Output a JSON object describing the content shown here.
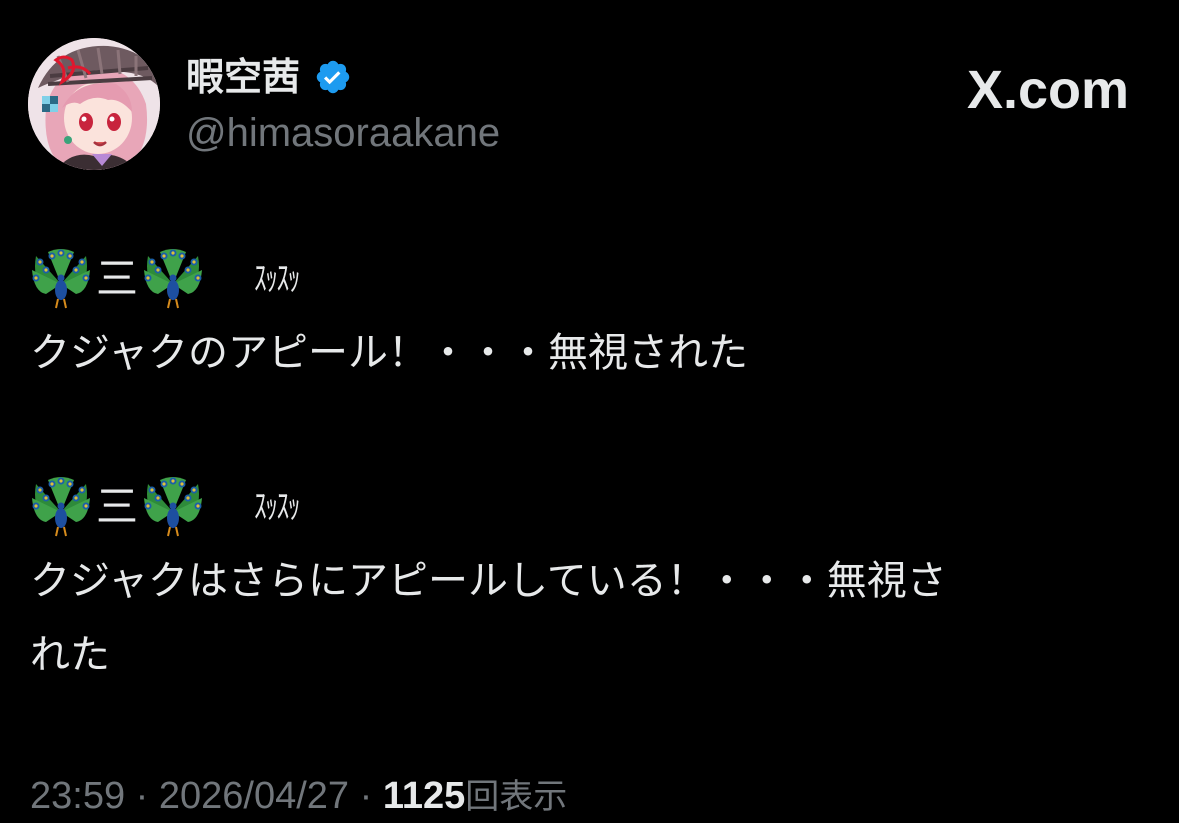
{
  "post": {
    "author": {
      "display_name": "暇空茜",
      "handle": "@himasoraakane",
      "verified_color": "#1d9bf0"
    },
    "brand": "X.com",
    "lines": {
      "l1_separator": "三",
      "l1_sfx": "ｽｯｽｯ",
      "l2": "クジャクのアピール！・・・無視された",
      "l3_separator": "三",
      "l3_sfx": "ｽｯｽｯ",
      "l4": "クジャクはさらにアピールしている！・・・無視さ",
      "l5": "れた"
    },
    "emoji": "peacock",
    "meta": {
      "time": "23:59",
      "dot1": " · ",
      "date": "2026/04/27",
      "dot2": " · ",
      "views_count": "1125",
      "views_label": "回表示"
    }
  },
  "colors": {
    "background": "#000000",
    "text": "#e7e9ea",
    "muted": "#71767b",
    "verified": "#1d9bf0"
  }
}
